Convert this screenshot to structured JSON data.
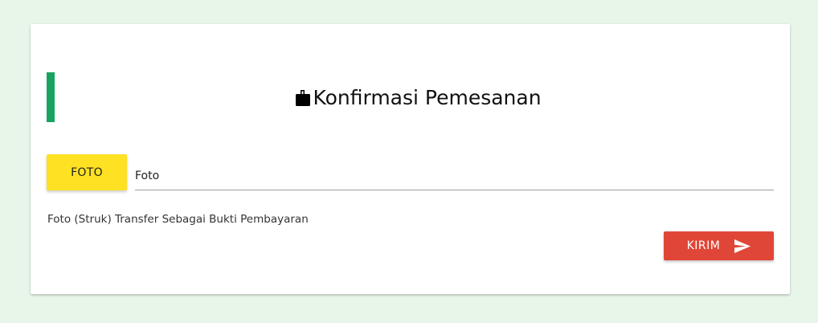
{
  "form": {
    "title": "Konfirmasi Pemesanan",
    "title_icon": "wallet-icon",
    "file_button_label": "FOTO",
    "file_path_value": "",
    "file_path_placeholder": "Foto",
    "helper_text": "Foto (Struk) Transfer Sebagai Bukti Pembayaran",
    "submit_label": "KIRIM",
    "submit_icon": "send-icon"
  },
  "colors": {
    "background": "#e8f5e9",
    "accent": "#1aa260",
    "file_button": "#ffe123",
    "submit_button": "#e04637"
  }
}
